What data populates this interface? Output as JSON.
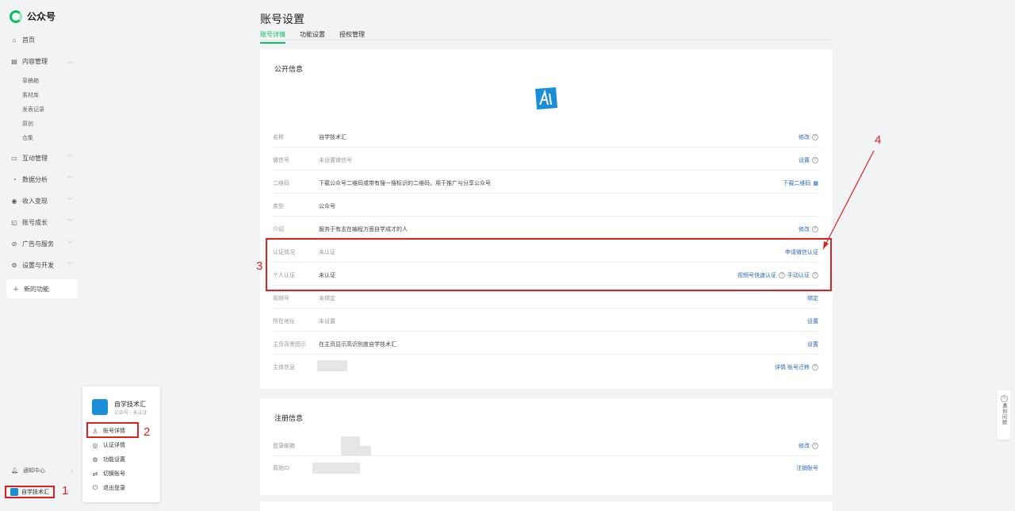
{
  "app": {
    "name": "公众号"
  },
  "sidebar": {
    "items": [
      {
        "label": "首页",
        "icon": "home-icon"
      },
      {
        "label": "内容管理",
        "icon": "content-icon"
      },
      {
        "label": "互动管理",
        "icon": "comment-icon"
      },
      {
        "label": "数据分析",
        "icon": "chart-icon"
      },
      {
        "label": "收入变现",
        "icon": "coin-icon"
      },
      {
        "label": "账号成长",
        "icon": "growth-icon"
      },
      {
        "label": "广告与服务",
        "icon": "ad-icon"
      },
      {
        "label": "设置与开发",
        "icon": "gear-icon"
      }
    ],
    "sub_items": [
      "草稿箱",
      "素材库",
      "发表记录",
      "原创",
      "合集"
    ],
    "new_func": "新的功能",
    "notification": "通知中心",
    "account": "自学技术汇"
  },
  "popup": {
    "name": "自学技术汇",
    "subtitle": "公众号 · 未认证",
    "items": [
      "账号详情",
      "认证详情",
      "功能设置",
      "切换账号",
      "退出登录"
    ]
  },
  "annotations": [
    "1",
    "2",
    "3",
    "4"
  ],
  "header": {
    "title": "账号设置",
    "tabs": [
      "账号详情",
      "功能设置",
      "授权管理"
    ]
  },
  "public_info": {
    "title": "公开信息",
    "rows": [
      {
        "label": "名称",
        "value": "自学技术汇",
        "action": "修改",
        "help": true
      },
      {
        "label": "微信号",
        "value": "未设置微信号",
        "action": "设置",
        "help": true,
        "muted": true
      },
      {
        "label": "二维码",
        "value": "下载公众号二维码或带有搜一搜标识的二维码，用于推广与分享公众号",
        "action": "下载二维码"
      },
      {
        "label": "类型",
        "value": "公众号",
        "action": ""
      },
      {
        "label": "介绍",
        "value": "服务于有志在编程方面自学成才的人",
        "action": "修改",
        "help": true
      },
      {
        "label": "认证情况",
        "value": "未认证",
        "action": "申请微信认证",
        "muted": true
      },
      {
        "label": "个人认证",
        "value": "未认证",
        "action": "视频号快速认证",
        "action2": "手动认证",
        "help": true
      },
      {
        "label": "视频号",
        "value": "未绑定",
        "action": "绑定",
        "muted": true
      },
      {
        "label": "所在地址",
        "value": "未设置",
        "action": "设置",
        "muted": true
      },
      {
        "label": "主页背景图示",
        "value": "在主页显示高识别度自学技术汇",
        "action": "设置"
      },
      {
        "label": "主体信息",
        "value": "",
        "action": "详情 账号迁移",
        "help": true
      }
    ]
  },
  "register_info": {
    "title": "注册信息",
    "rows": [
      {
        "label": "登录邮箱",
        "value": "",
        "action": "修改",
        "help": true
      },
      {
        "label": "原始ID",
        "value": "",
        "action": "注销账号"
      }
    ]
  },
  "float_help": {
    "label": "遇到问题"
  },
  "colors": {
    "accent": "#07c160",
    "link": "#2a6ab8",
    "annotation": "#e02020",
    "brand_logo": "#1a8fd8"
  }
}
